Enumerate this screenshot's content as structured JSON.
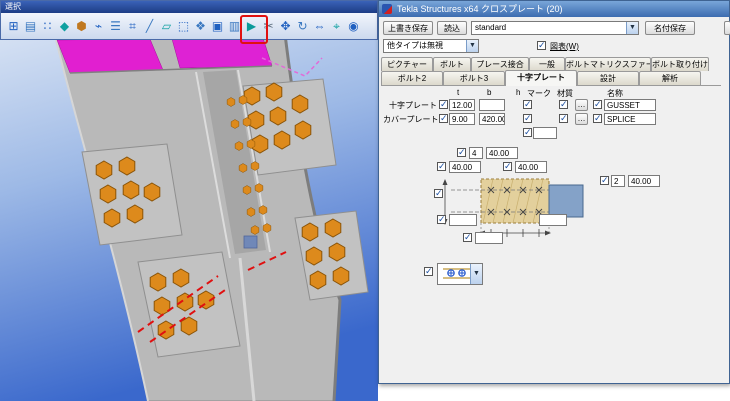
{
  "toolbar": {
    "title": "選択",
    "highlight_index": 14,
    "icons": [
      {
        "name": "select-all-icon",
        "glyph": "⊞",
        "color": "#2060c0"
      },
      {
        "name": "select-parts-icon",
        "glyph": "▤",
        "color": "#3a78c0"
      },
      {
        "name": "select-points-icon",
        "glyph": "∷",
        "color": "#2060c0"
      },
      {
        "name": "select-component-icon",
        "glyph": "◆",
        "color": "#0fa0a0"
      },
      {
        "name": "select-bolt-icon",
        "glyph": "⬢",
        "color": "#c07820"
      },
      {
        "name": "select-weld-icon",
        "glyph": "⌁",
        "color": "#2060c0"
      },
      {
        "name": "select-rebar-icon",
        "glyph": "☰",
        "color": "#3a78c0"
      },
      {
        "name": "select-grid-icon",
        "glyph": "⌗",
        "color": "#2060c0"
      },
      {
        "name": "select-line-icon",
        "glyph": "╱",
        "color": "#3a78c0"
      },
      {
        "name": "select-plane-icon",
        "glyph": "▱",
        "color": "#0fa0a0"
      },
      {
        "name": "select-view-icon",
        "glyph": "⬚",
        "color": "#2060c0"
      },
      {
        "name": "select-assembly-icon",
        "glyph": "❖",
        "color": "#3a78c0"
      },
      {
        "name": "select-object-icon",
        "glyph": "▣",
        "color": "#2060c0"
      },
      {
        "name": "select-filter-icon",
        "glyph": "▥",
        "color": "#3a78c0"
      },
      {
        "name": "select-switch-icon",
        "glyph": "▶",
        "color": "#0a9a9a"
      },
      {
        "name": "select-cut-icon",
        "glyph": "✂",
        "color": "#607080"
      },
      {
        "name": "select-move-icon",
        "glyph": "✥",
        "color": "#2060c0"
      },
      {
        "name": "select-rotate-icon",
        "glyph": "↻",
        "color": "#3a78c0"
      },
      {
        "name": "select-measure-icon",
        "glyph": "⇔",
        "color": "#2060c0"
      },
      {
        "name": "select-zoom-icon",
        "glyph": "⌖",
        "color": "#0fa0a0"
      },
      {
        "name": "select-snap-icon",
        "glyph": "◉",
        "color": "#2060c0"
      }
    ]
  },
  "dialog": {
    "title": "Tekla Structures x64 クロスプレート (20)",
    "buttons": {
      "save": "上書き保存",
      "load": "読込",
      "save_as": "名付保存"
    },
    "profile_value": "standard",
    "ignore_other_types": "他タイプは無視",
    "diagram_label": "図表(W)",
    "tabs_row1": [
      "ピクチャー",
      "ボルト",
      "プレース接合",
      "一般",
      "ボルトマトリクスファー",
      "ボルト取り付け"
    ],
    "tabs_row2": [
      "ボルト2",
      "ボルト3",
      "十字プレート",
      "設計",
      "解析"
    ],
    "active_tab": "十字プレート",
    "browse_label": "…",
    "table": {
      "headers": {
        "t": "t",
        "b": "b",
        "h": "h",
        "mark": "マーク",
        "material": "材質",
        "name": "名称"
      },
      "rows": [
        {
          "label": "十字プレート",
          "t": "12.00",
          "b": "",
          "h": "",
          "name": "GUSSET"
        },
        {
          "label": "カバープレート",
          "t": "9.00",
          "b": "420.00",
          "h": "",
          "name": "SPLICE"
        }
      ]
    },
    "fields": {
      "rows_count": "4",
      "row_pitch": "40.00",
      "edge_left": "40.00",
      "edge_mid": "40.00",
      "cols_count": "2",
      "col_pitch": "40.00",
      "dim_a": "",
      "dim_b": "",
      "dim_c": "",
      "mark_extra": ""
    }
  }
}
